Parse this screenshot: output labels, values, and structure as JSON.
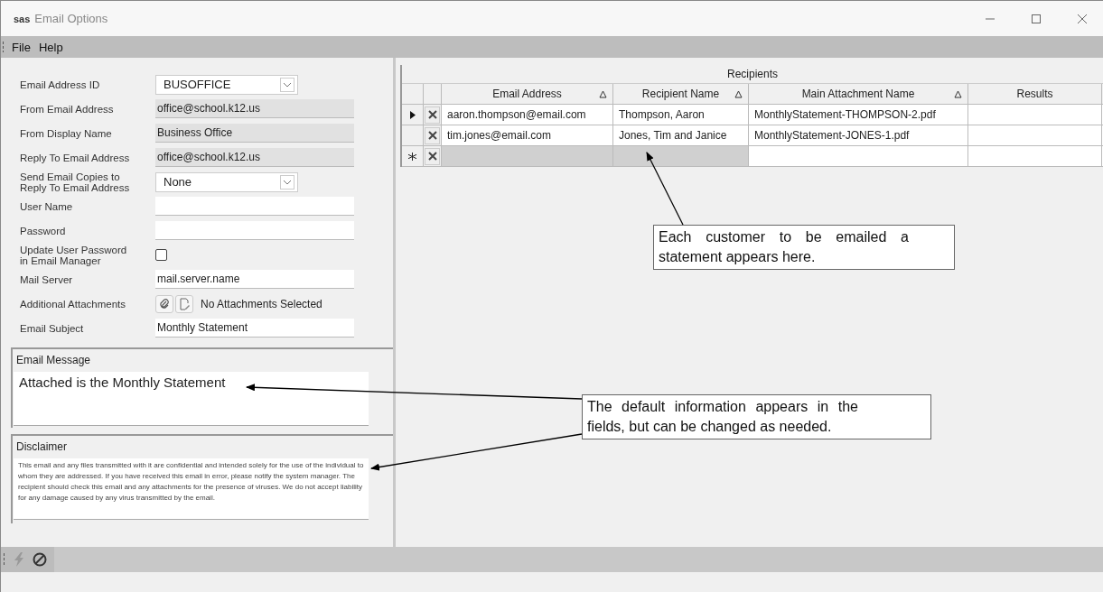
{
  "window": {
    "badge": "sas",
    "title": "Email Options"
  },
  "menu": [
    {
      "label": "File"
    },
    {
      "label": "Help"
    }
  ],
  "form": {
    "fields": [
      {
        "kind": "combo",
        "label": "Email Address ID",
        "value": "BUSOFFICE"
      },
      {
        "kind": "readonly",
        "label": "From Email Address",
        "value": "office@school.k12.us"
      },
      {
        "kind": "readonly",
        "label": "From Display Name",
        "value": "Business Office"
      },
      {
        "kind": "readonly",
        "label": "Reply To Email Address",
        "value": "office@school.k12.us"
      },
      {
        "kind": "combo",
        "label": "Send Email Copies to Reply To Email Address",
        "value": "None"
      },
      {
        "kind": "text",
        "label": "User Name"
      },
      {
        "kind": "text",
        "label": "Password"
      },
      {
        "kind": "checkbox",
        "label": "Update User Password in Email Manager",
        "checked": false
      },
      {
        "kind": "text",
        "label": "Mail Server",
        "value": "mail.server.name"
      },
      {
        "kind": "attachments",
        "label": "Additional Attachments",
        "value": "No Attachments Selected"
      },
      {
        "kind": "text",
        "label": "Email Subject",
        "value": "Monthly Statement"
      }
    ]
  },
  "email_message": {
    "title": "Email Message",
    "text": "Attached is the Monthly Statement"
  },
  "disclaimer": {
    "title": "Disclaimer",
    "text": "This email and any files transmitted with it are confidential and intended solely for the use of the individual to whom they are addressed.  If you have received this email in error, please notify the system manager.  The recipient should check this email and any attachments for the presence of viruses.  We do not accept liability for any damage caused by any virus transmitted by the email."
  },
  "recipients": {
    "title": "Recipients",
    "columns": [
      {
        "label": "Email Address",
        "sortable": true
      },
      {
        "label": "Recipient Name",
        "sortable": true
      },
      {
        "label": "Main Attachment Name",
        "sortable": true
      },
      {
        "label": "Results",
        "sortable": false
      }
    ],
    "rows": [
      {
        "kind": "current",
        "cells": [
          "aaron.thompson@email.com",
          "Thompson, Aaron",
          "MonthlyStatement-THOMPSON-2.pdf",
          ""
        ]
      },
      {
        "kind": "normal",
        "cells": [
          "tim.jones@email.com",
          "Jones, Tim and Janice",
          "MonthlyStatement-JONES-1.pdf",
          ""
        ]
      },
      {
        "kind": "new",
        "cells": [
          "",
          "",
          "",
          ""
        ]
      }
    ]
  },
  "callouts": [
    {
      "text": "Each customer to be emailed a statement appears here."
    },
    {
      "text": "The default information appears in the fields, but can be changed as needed."
    }
  ]
}
